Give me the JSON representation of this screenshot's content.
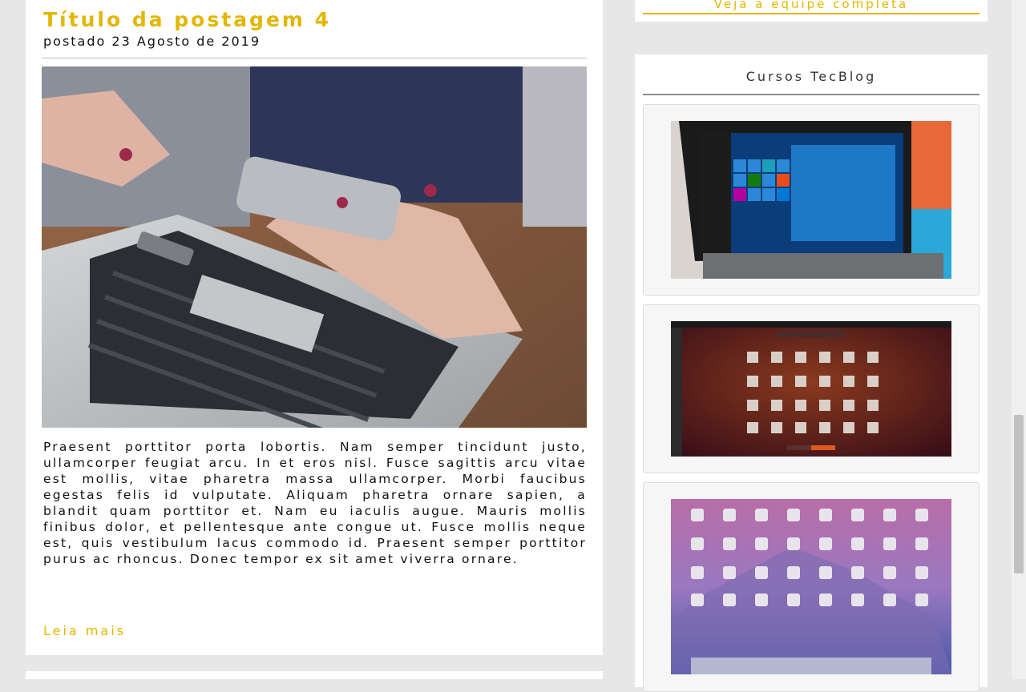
{
  "post": {
    "title": "Título da postagem 4",
    "date": "postado 23 Agosto de 2019",
    "body": "Praesent porttitor porta lobortis. Nam semper tincidunt justo, ullamcorper feugiat arcu. In et eros nisl. Fusce sagittis arcu vitae est mollis, vitae pharetra massa ullamcorper. Morbi faucibus egestas felis id vulputate. Aliquam pharetra ornare sapien, a blandit quam porttitor et. Nam eu iaculis augue. Mauris mollis finibus dolor, et pellentesque ante congue ut. Fusce mollis neque est, quis vestibulum lacus commodo id. Praesent semper porttitor purus ac rhoncus. Donec tempor ex sit amet viverra ornare.",
    "read_more": "Leia mais"
  },
  "sidebar": {
    "team_link": "Veja a equipe completa",
    "courses_title": "Cursos TecBlog"
  },
  "colors": {
    "accent": "#e3b600",
    "background": "#e7e7e7",
    "card": "#ffffff"
  }
}
